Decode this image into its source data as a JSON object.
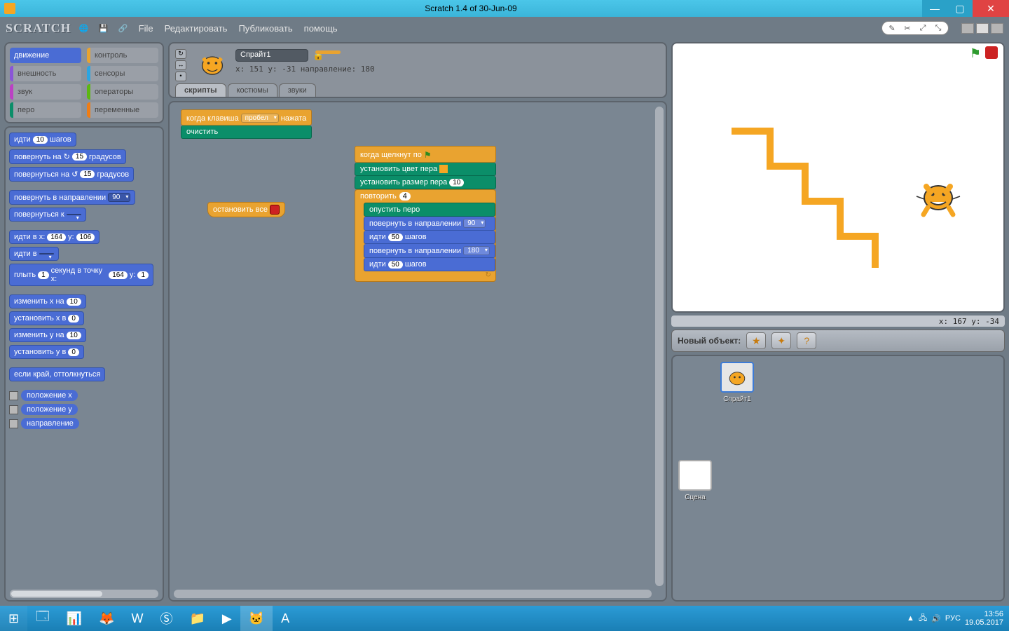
{
  "window": {
    "title": "Scratch 1.4 of 30-Jun-09"
  },
  "toolbar": {
    "logo": "SCRATCH",
    "menus": [
      "File",
      "Редактировать",
      "Публиковать",
      "помощь"
    ]
  },
  "categories": {
    "motion": "движение",
    "control": "контроль",
    "looks": "внешность",
    "sensing": "сенсоры",
    "sound": "звук",
    "operators": "операторы",
    "pen": "перо",
    "variables": "переменные"
  },
  "palette_blocks": {
    "move": {
      "pre": "идти",
      "val": "10",
      "post": "шагов"
    },
    "turn_cw": {
      "pre": "повернуть на ↻",
      "val": "15",
      "post": "градусов"
    },
    "turn_ccw": {
      "pre": "повернуться на ↺",
      "val": "15",
      "post": "градусов"
    },
    "point_dir": {
      "pre": "повернуть в направлении",
      "val": "90"
    },
    "point_to": {
      "pre": "повернуться к",
      "dd": " "
    },
    "goto_xy": {
      "pre": "идти в х:",
      "x": "164",
      "mid": "у:",
      "y": "106"
    },
    "goto": {
      "pre": "идти в",
      "dd": " "
    },
    "glide": {
      "pre": "плыть",
      "sec": "1",
      "mid": "секунд в точку х:",
      "x": "164",
      "mid2": "у:",
      "y": "1"
    },
    "change_x": {
      "pre": "изменить х на",
      "val": "10"
    },
    "set_x": {
      "pre": "установить х в",
      "val": "0"
    },
    "change_y": {
      "pre": "изменить у на",
      "val": "10"
    },
    "set_y": {
      "pre": "установить у в",
      "val": "0"
    },
    "bounce": {
      "text": "если край, оттолкнуться"
    },
    "rep_x": "положение х",
    "rep_y": "положение у",
    "rep_dir": "направление"
  },
  "sprite_header": {
    "name": "Спрайт1",
    "coords": "x: 151  y: -31  направление: 180"
  },
  "tabs": {
    "scripts": "скрипты",
    "costumes": "костюмы",
    "sounds": "звуки"
  },
  "scripts": {
    "s1_key": {
      "pre": "когда клавиша",
      "key": "пробел",
      "post": "нажата"
    },
    "s1_clear": "очистить",
    "s_stop": "остановить все",
    "s2_flag": "когда щелкнут по",
    "s2_pencolor": "установить цвет пера",
    "s2_pensize": {
      "pre": "установить размер пера",
      "val": "10"
    },
    "s2_repeat": {
      "pre": "повторить",
      "val": "4"
    },
    "s2_pendown": "опустить перо",
    "s2_point": {
      "pre": "повернуть в направлении",
      "val": "90"
    },
    "s2_move": {
      "pre": "идти",
      "val": "50",
      "post": "шагов"
    },
    "s2_point2": {
      "pre": "повернуть в направлении",
      "val": "180"
    },
    "s2_move2": {
      "pre": "идти",
      "val": "50",
      "post": "шагов"
    }
  },
  "stage": {
    "coords": "x: 167   y: -34",
    "new_object": "Новый объект:",
    "sprite_name": "Спрайт1",
    "stage_name": "Сцена"
  },
  "taskbar": {
    "lang": "РУС",
    "time": "13:56",
    "date": "19.05.2017"
  }
}
